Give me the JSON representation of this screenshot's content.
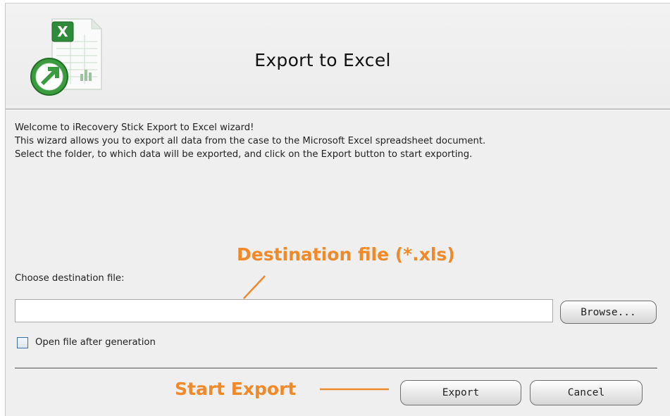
{
  "dialog": {
    "title": "Export to Excel"
  },
  "intro": {
    "line1": "Welcome to iRecovery Stick Export to Excel wizard!",
    "line2": "This wizard allows you to export all data from the case to the Microsoft Excel spreadsheet document.",
    "line3": "Select the folder, to which data will be exported, and click on the Export button to start exporting."
  },
  "destination": {
    "label": "Choose destination file:",
    "value": "",
    "browse_label": "Browse..."
  },
  "options": {
    "open_after_label": "Open file after generation",
    "open_after_checked": false
  },
  "actions": {
    "export_label": "Export",
    "cancel_label": "Cancel"
  },
  "annotations": {
    "destination": "Destination file (*.xls)",
    "start_export": "Start Export",
    "color": "#f0892a"
  },
  "icons": {
    "logo": "excel-export-icon"
  }
}
